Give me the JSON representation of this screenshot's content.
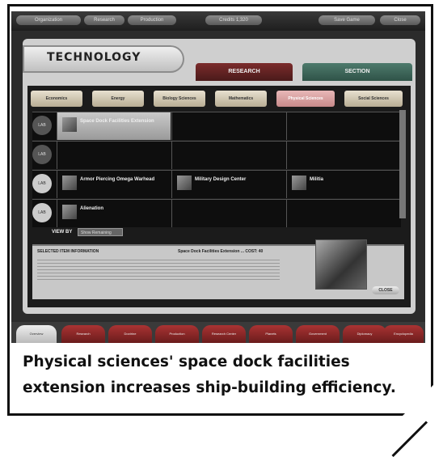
{
  "screen": {
    "top_menu": [
      "Organization",
      "Research",
      "Production",
      "Credits 1,320",
      "Save Game",
      "Close"
    ],
    "title": "TECHNOLOGY",
    "main_tabs": [
      "RESEARCH",
      "SECTION"
    ],
    "sub_tabs": [
      "Economics",
      "Energy",
      "Biology Sciences",
      "Mathematics",
      "Physical Sciences",
      "Social Sciences"
    ],
    "active_sub_tab": "Physical Sciences",
    "rows": [
      {
        "lab": "LAB",
        "items": [
          "Space Dock Facilities Extension",
          "",
          ""
        ]
      },
      {
        "lab": "LAB",
        "items": [
          "",
          "",
          ""
        ]
      },
      {
        "lab": "LAB",
        "items": [
          "Armor Piercing Omega Warhead",
          "Military Design Center",
          "Militia"
        ]
      },
      {
        "lab": "LAB",
        "items": [
          "Alienation",
          "",
          ""
        ]
      }
    ],
    "view_by_label": "VIEW BY",
    "view_by_value": "Show Remaining",
    "info_header": "SELECTED ITEM INFORMATION",
    "info_item": "Space Dock Facilities Extension ... COST: 40",
    "close_label": "CLOSE",
    "bottom_tabs": [
      "Overview",
      "Research",
      "Doctrine",
      "Production",
      "Research Center",
      "Planets",
      "Government",
      "Diplomacy",
      "Encyclopedia"
    ]
  },
  "caption": "Physical sciences' space dock facilities extension increases ship-building efficiency."
}
